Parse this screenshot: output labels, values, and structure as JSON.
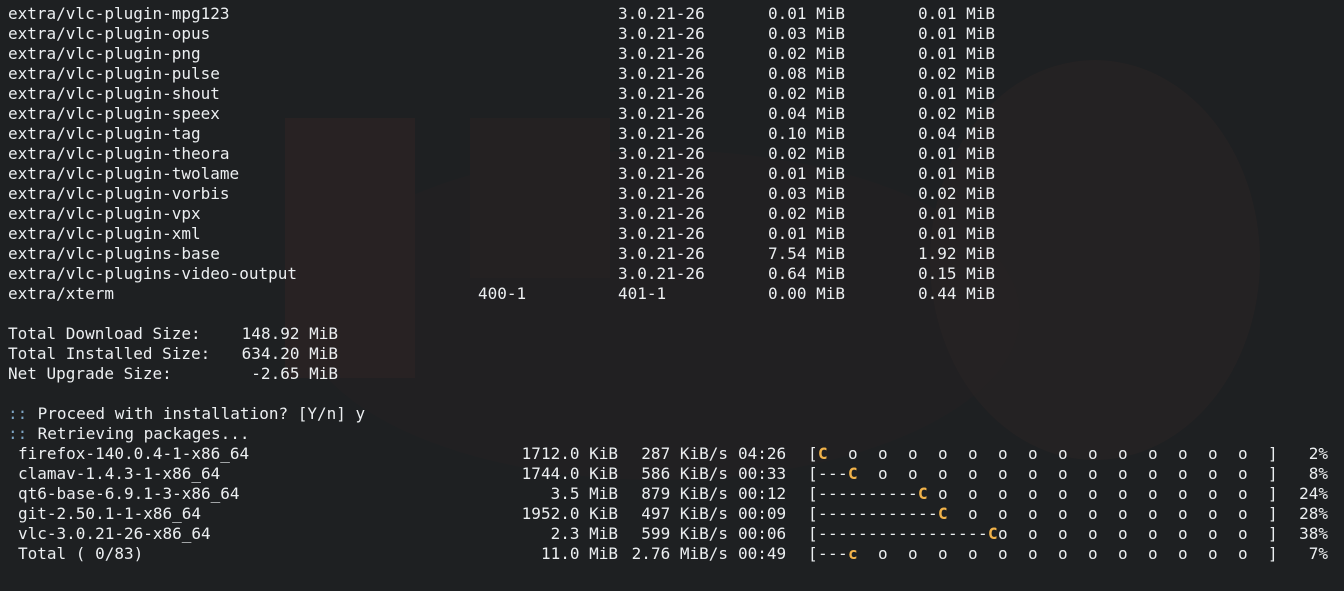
{
  "packages": [
    {
      "name": "extra/vlc-plugin-mpg123",
      "old": "",
      "new": "3.0.21-26",
      "net": "0.01 MiB",
      "download": "0.01 MiB"
    },
    {
      "name": "extra/vlc-plugin-opus",
      "old": "",
      "new": "3.0.21-26",
      "net": "0.03 MiB",
      "download": "0.01 MiB"
    },
    {
      "name": "extra/vlc-plugin-png",
      "old": "",
      "new": "3.0.21-26",
      "net": "0.02 MiB",
      "download": "0.01 MiB"
    },
    {
      "name": "extra/vlc-plugin-pulse",
      "old": "",
      "new": "3.0.21-26",
      "net": "0.08 MiB",
      "download": "0.02 MiB"
    },
    {
      "name": "extra/vlc-plugin-shout",
      "old": "",
      "new": "3.0.21-26",
      "net": "0.02 MiB",
      "download": "0.01 MiB"
    },
    {
      "name": "extra/vlc-plugin-speex",
      "old": "",
      "new": "3.0.21-26",
      "net": "0.04 MiB",
      "download": "0.02 MiB"
    },
    {
      "name": "extra/vlc-plugin-tag",
      "old": "",
      "new": "3.0.21-26",
      "net": "0.10 MiB",
      "download": "0.04 MiB"
    },
    {
      "name": "extra/vlc-plugin-theora",
      "old": "",
      "new": "3.0.21-26",
      "net": "0.02 MiB",
      "download": "0.01 MiB"
    },
    {
      "name": "extra/vlc-plugin-twolame",
      "old": "",
      "new": "3.0.21-26",
      "net": "0.01 MiB",
      "download": "0.01 MiB"
    },
    {
      "name": "extra/vlc-plugin-vorbis",
      "old": "",
      "new": "3.0.21-26",
      "net": "0.03 MiB",
      "download": "0.02 MiB"
    },
    {
      "name": "extra/vlc-plugin-vpx",
      "old": "",
      "new": "3.0.21-26",
      "net": "0.02 MiB",
      "download": "0.01 MiB"
    },
    {
      "name": "extra/vlc-plugin-xml",
      "old": "",
      "new": "3.0.21-26",
      "net": "0.01 MiB",
      "download": "0.01 MiB"
    },
    {
      "name": "extra/vlc-plugins-base",
      "old": "",
      "new": "3.0.21-26",
      "net": "7.54 MiB",
      "download": "1.92 MiB"
    },
    {
      "name": "extra/vlc-plugins-video-output",
      "old": "",
      "new": "3.0.21-26",
      "net": "0.64 MiB",
      "download": "0.15 MiB"
    },
    {
      "name": "extra/xterm",
      "old": "400-1",
      "new": "401-1",
      "net": "0.00 MiB",
      "download": "0.44 MiB"
    }
  ],
  "totals": [
    {
      "label": "Total Download Size:",
      "value": "148.92 MiB"
    },
    {
      "label": "Total Installed Size:",
      "value": "634.20 MiB"
    },
    {
      "label": "Net Upgrade Size:",
      "value": "-2.65 MiB"
    }
  ],
  "prompts": [
    {
      "marker": "::",
      "text": " Proceed with installation? [Y/n] y"
    },
    {
      "marker": "::",
      "text": " Retrieving packages..."
    }
  ],
  "downloads": [
    {
      "name": "firefox-140.0.4-1-x86_64",
      "size": "1712.0 KiB",
      "speed": "287 KiB/s",
      "eta": "04:26",
      "bar": "[C  o  o  o  o  o  o  o  o  o  o  o  o  o  o  ]",
      "progress": "2%"
    },
    {
      "name": "clamav-1.4.3-1-x86_64",
      "size": "1744.0 KiB",
      "speed": "586 KiB/s",
      "eta": "00:33",
      "bar": "[---C  o  o  o  o  o  o  o  o  o  o  o  o  o  ]",
      "progress": "8%"
    },
    {
      "name": "qt6-base-6.9.1-3-x86_64",
      "size": "3.5 MiB",
      "speed": "879 KiB/s",
      "eta": "00:12",
      "bar": "[----------C o  o  o  o  o  o  o  o  o  o  o  ]",
      "progress": "24%"
    },
    {
      "name": "git-2.50.1-1-x86_64",
      "size": "1952.0 KiB",
      "speed": "497 KiB/s",
      "eta": "00:09",
      "bar": "[------------C  o  o  o  o  o  o  o  o  o  o  ]",
      "progress": "28%"
    },
    {
      "name": "vlc-3.0.21-26-x86_64",
      "size": "2.3 MiB",
      "speed": "599 KiB/s",
      "eta": "00:06",
      "bar": "[-----------------Co  o  o  o  o  o  o  o  o  ]",
      "progress": "38%"
    },
    {
      "name": "Total ( 0/83)",
      "size": "11.0 MiB",
      "speed": "2.76 MiB/s",
      "eta": "00:49",
      "bar": "[---c  o  o  o  o  o  o  o  o  o  o  o  o  o  ]",
      "progress": "7%"
    }
  ],
  "colors": {
    "background": "#1e2022",
    "foreground": "#eceff1",
    "prompt_marker": "#7fa5c4",
    "pacman": "#f2b34a"
  }
}
